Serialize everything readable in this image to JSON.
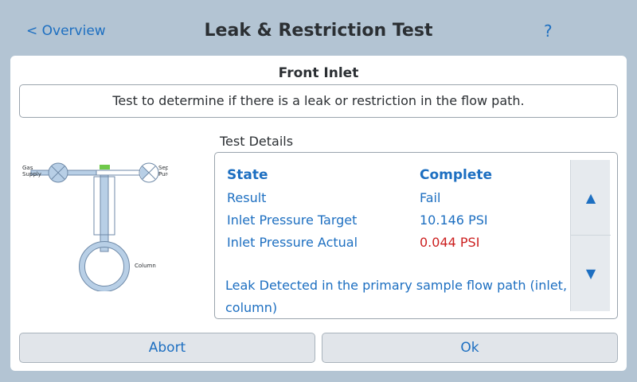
{
  "header": {
    "back_label": "< Overview",
    "title": "Leak & Restriction Test",
    "help_label": "?"
  },
  "section": {
    "title": "Front Inlet",
    "description": "Test to determine if there is a leak or restriction in the flow path."
  },
  "diagram": {
    "gas_supply_label": [
      "Gas",
      "Supply"
    ],
    "septum_purge_label": [
      "Septum",
      "Purge"
    ],
    "column_label": "Column"
  },
  "details": {
    "label": "Test Details",
    "rows": [
      {
        "name": "State",
        "value": "Complete"
      },
      {
        "name": "Result",
        "value": "Fail"
      },
      {
        "name": "Inlet Pressure Target",
        "value": "10.146 PSI"
      },
      {
        "name": "Inlet Pressure Actual",
        "value": "0.044 PSI"
      }
    ],
    "message": "Leak Detected in the primary sample flow path (inlet, column)",
    "scroll_up_icon": "▲",
    "scroll_down_icon": "▼",
    "alert_color": "#cc1f1f"
  },
  "buttons": {
    "abort": "Abort",
    "ok": "Ok"
  },
  "colors": {
    "background": "#b3c4d3",
    "accent": "#1d6fc1",
    "indicator_green": "#6fc94a"
  }
}
